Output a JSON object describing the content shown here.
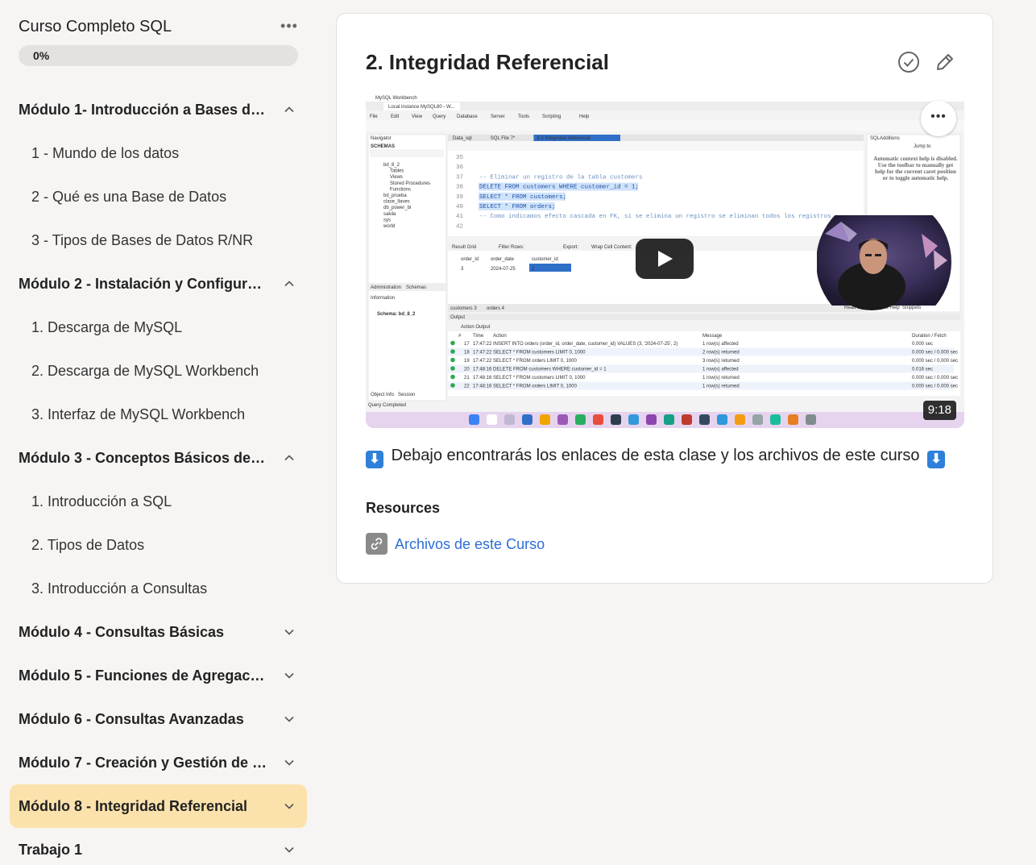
{
  "sidebar": {
    "course_title": "Curso Completo SQL",
    "menu_icon": "more-horizontal-icon",
    "progress": {
      "label": "0%",
      "value": 0
    },
    "modules": [
      {
        "label": "Módulo 1- Introducción a Bases de …",
        "expanded": true,
        "lessons": [
          "1 - Mundo de los datos",
          "2 - Qué es una Base de Datos",
          "3 - Tipos de Bases de Datos R/NR"
        ]
      },
      {
        "label": "Módulo 2 - Instalación y Configurac…",
        "expanded": true,
        "lessons": [
          "1. Descarga de MySQL",
          "2. Descarga de MySQL Workbench",
          "3. Interfaz de MySQL Workbench"
        ]
      },
      {
        "label": "Módulo 3 - Conceptos Básicos de S…",
        "expanded": true,
        "lessons": [
          "1. Introducción a SQL",
          "2. Tipos de Datos",
          "3. Introducción a Consultas"
        ]
      },
      {
        "label": "Módulo 4 - Consultas Básicas",
        "expanded": false,
        "lessons": []
      },
      {
        "label": "Módulo 5 - Funciones de Agregación",
        "expanded": false,
        "lessons": []
      },
      {
        "label": "Módulo 6 - Consultas Avanzadas",
        "expanded": false,
        "lessons": []
      },
      {
        "label": "Módulo 7 - Creación y Gestión de T…",
        "expanded": false,
        "lessons": []
      },
      {
        "label": "Módulo 8 - Integridad Referencial",
        "expanded": false,
        "active": true,
        "lessons": []
      },
      {
        "label": "Trabajo 1",
        "expanded": false,
        "lessons": []
      }
    ]
  },
  "main": {
    "title": "2. Integridad Referencial",
    "complete_icon": "check-circle-icon",
    "edit_icon": "pencil-icon",
    "video": {
      "duration": "9:18",
      "more_label": "•••",
      "window_title": "MySQL Workbench",
      "instance_tab": "Local instance MySQL80 - W...",
      "menu": [
        "File",
        "Edit",
        "View",
        "Query",
        "Database",
        "Server",
        "Tools",
        "Scripting",
        "Help"
      ],
      "editor_tabs": [
        "Data_sql",
        "SQL File 7*",
        "8.2 Integridad referencial"
      ],
      "line_numbers": [
        "35",
        "36",
        "37",
        "38",
        "39",
        "40",
        "41",
        "42"
      ],
      "code_lines": [
        "",
        "",
        "-- Eliminar un registro de la tabla customers",
        "DELETE FROM customers WHERE customer_id = 1;",
        "SELECT * FROM customers;",
        "SELECT * FROM orders;",
        "-- Como indicamos efecto cascada en FK, si se elimina un registro se eliminan todos los registros",
        ""
      ],
      "schemas": [
        "bd_8_2",
        "Tables",
        "Views",
        "Stored Procedures",
        "Functions",
        "bd_prueba",
        "clase_llaves",
        "db_power_bi",
        "sakila",
        "sys",
        "world"
      ],
      "result_headers": [
        "order_id",
        "order_date",
        "customer_id"
      ],
      "result_row": [
        "3",
        "2024-07-25",
        "2"
      ],
      "context_help": "Automatic context help is disabled. Use the toolbar to manually get help for the current caret position or to toggle automatic help.",
      "schema_info": "Schema: bd_8_2",
      "output_rows": [
        [
          "17",
          "17:47:22",
          "INSERT INTO orders (order_id, order_date, customer_id) VALUES (3, '2024-07-25', 2)",
          "1 row(s) affected",
          "0.000 sec"
        ],
        [
          "18",
          "17:47:22",
          "SELECT * FROM customers LIMIT 0, 1000",
          "2 row(s) returned",
          "0.000 sec / 0.000 sec"
        ],
        [
          "19",
          "17:47:22",
          "SELECT * FROM orders LIMIT 0, 1000",
          "3 row(s) returned",
          "0.000 sec / 0.000 sec"
        ],
        [
          "20",
          "17:48:16",
          "DELETE FROM customers WHERE customer_id = 1",
          "1 row(s) affected",
          "0.016 sec"
        ],
        [
          "21",
          "17:48:16",
          "SELECT * FROM customers LIMIT 0, 1000",
          "1 row(s) returned",
          "0.000 sec / 0.000 sec"
        ],
        [
          "22",
          "17:48:16",
          "SELECT * FROM orders LIMIT 0, 1000",
          "1 row(s) returned",
          "0.000 sec / 0.000 sec"
        ]
      ],
      "status": "Query Completed"
    },
    "description": "Debajo encontrarás los enlaces de esta clase y los archivos de este curso",
    "arrow_glyph": "⬇",
    "resources_heading": "Resources",
    "resources": [
      {
        "label": "Archivos de este Curso",
        "icon": "link-icon"
      }
    ]
  },
  "colors": {
    "active_module": "#fbe2ac",
    "link": "#2d6ed6",
    "progress_track": "#e4e2e0"
  }
}
